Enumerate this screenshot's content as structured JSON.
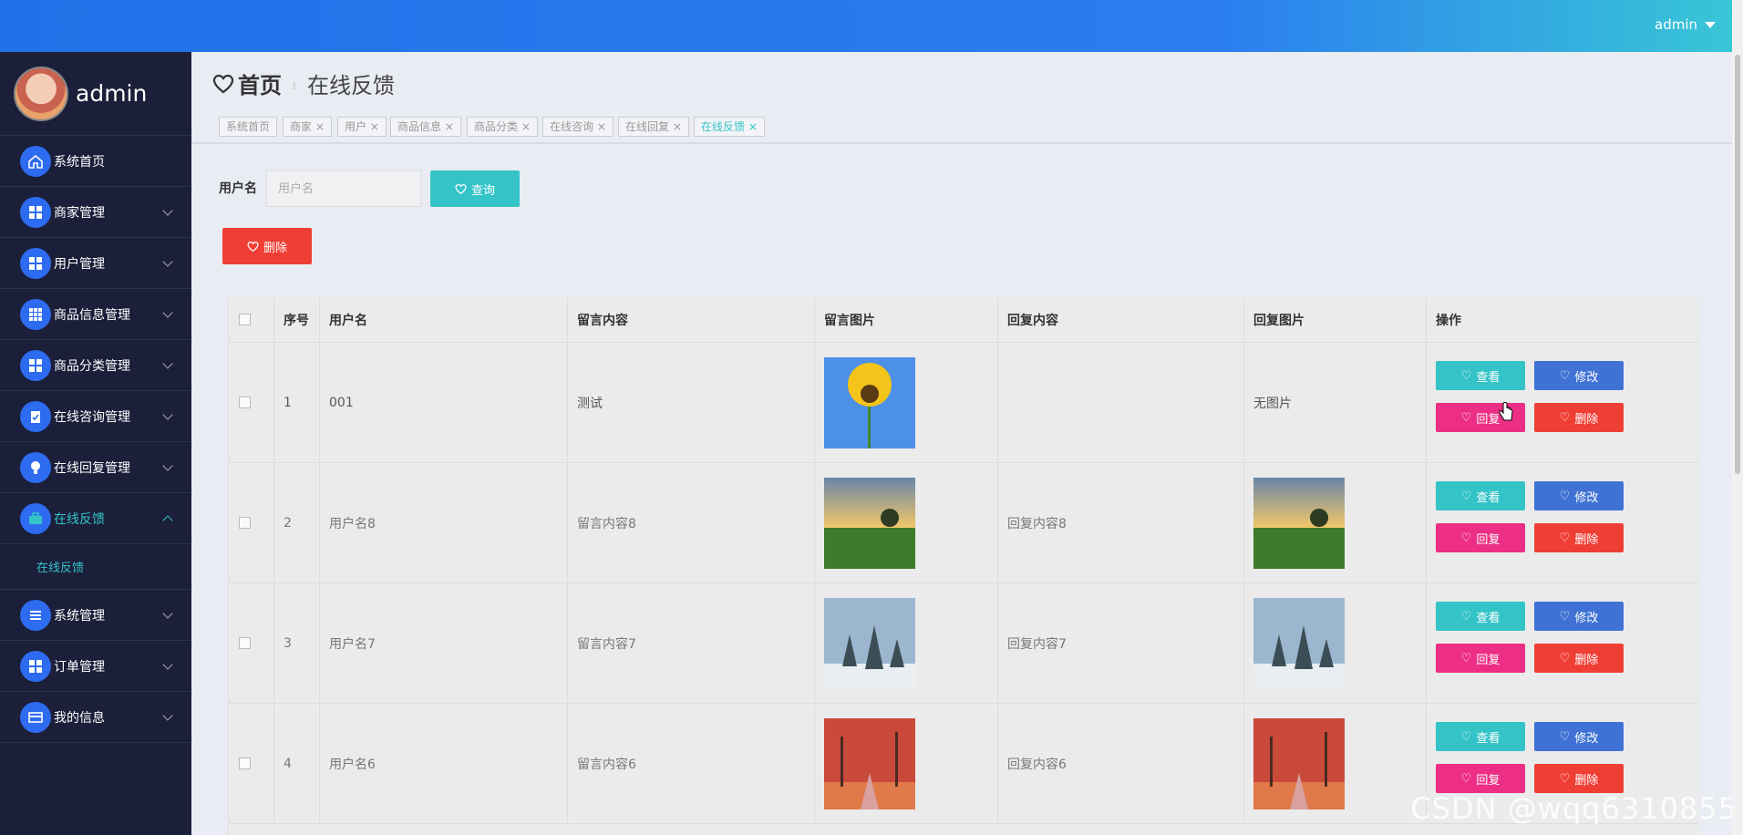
{
  "topbar": {
    "user": "admin"
  },
  "sidebar": {
    "profile_name": "admin",
    "items": [
      {
        "label": "系统首页",
        "icon": "home-icon"
      },
      {
        "label": "商家管理",
        "icon": "grid-icon"
      },
      {
        "label": "用户管理",
        "icon": "grid-icon"
      },
      {
        "label": "商品信息管理",
        "icon": "grid-icon"
      },
      {
        "label": "商品分类管理",
        "icon": "grid-icon"
      },
      {
        "label": "在线咨询管理",
        "icon": "clipboard-icon"
      },
      {
        "label": "在线回复管理",
        "icon": "bulb-icon"
      },
      {
        "label": "在线反馈",
        "icon": "briefcase-icon",
        "active": true
      },
      {
        "label": "系统管理",
        "icon": "list-icon"
      },
      {
        "label": "订单管理",
        "icon": "grid-icon"
      },
      {
        "label": "我的信息",
        "icon": "card-icon"
      }
    ],
    "sub_item": "在线反馈"
  },
  "header": {
    "home": "首页",
    "current": "在线反馈"
  },
  "tags": [
    "系统首页",
    "商家",
    "用户",
    "商品信息",
    "商品分类",
    "在线咨询",
    "在线回复",
    "在线反馈"
  ],
  "search": {
    "label": "用户名",
    "placeholder": "用户名",
    "button": "查询"
  },
  "toolbar": {
    "delete": "删除"
  },
  "table": {
    "headers": [
      "序号",
      "用户名",
      "留言内容",
      "留言图片",
      "回复内容",
      "回复图片",
      "操作"
    ],
    "rows": [
      {
        "index": "1",
        "user": "001",
        "content": "测试",
        "image": "sunflower",
        "reply": "",
        "reply_image": "无图片"
      },
      {
        "index": "2",
        "user": "用户名8",
        "content": "留言内容8",
        "image": "field",
        "reply": "回复内容8",
        "reply_image": "field"
      },
      {
        "index": "3",
        "user": "用户名7",
        "content": "留言内容7",
        "image": "snow",
        "reply": "回复内容7",
        "reply_image": "snow"
      },
      {
        "index": "4",
        "user": "用户名6",
        "content": "留言内容6",
        "image": "autumn",
        "reply": "回复内容6",
        "reply_image": "autumn"
      }
    ],
    "ops": {
      "view": "查看",
      "edit": "修改",
      "reply": "回复",
      "delete": "删除"
    }
  },
  "watermark": "CSDN @wqq6310855",
  "colors": {
    "topbar": "#2171e8",
    "sidebar": "#1b1f3a",
    "teal": "#34c3c7",
    "blue": "#3f72d4",
    "pink": "#ec2f84",
    "red": "#ef3f35"
  }
}
